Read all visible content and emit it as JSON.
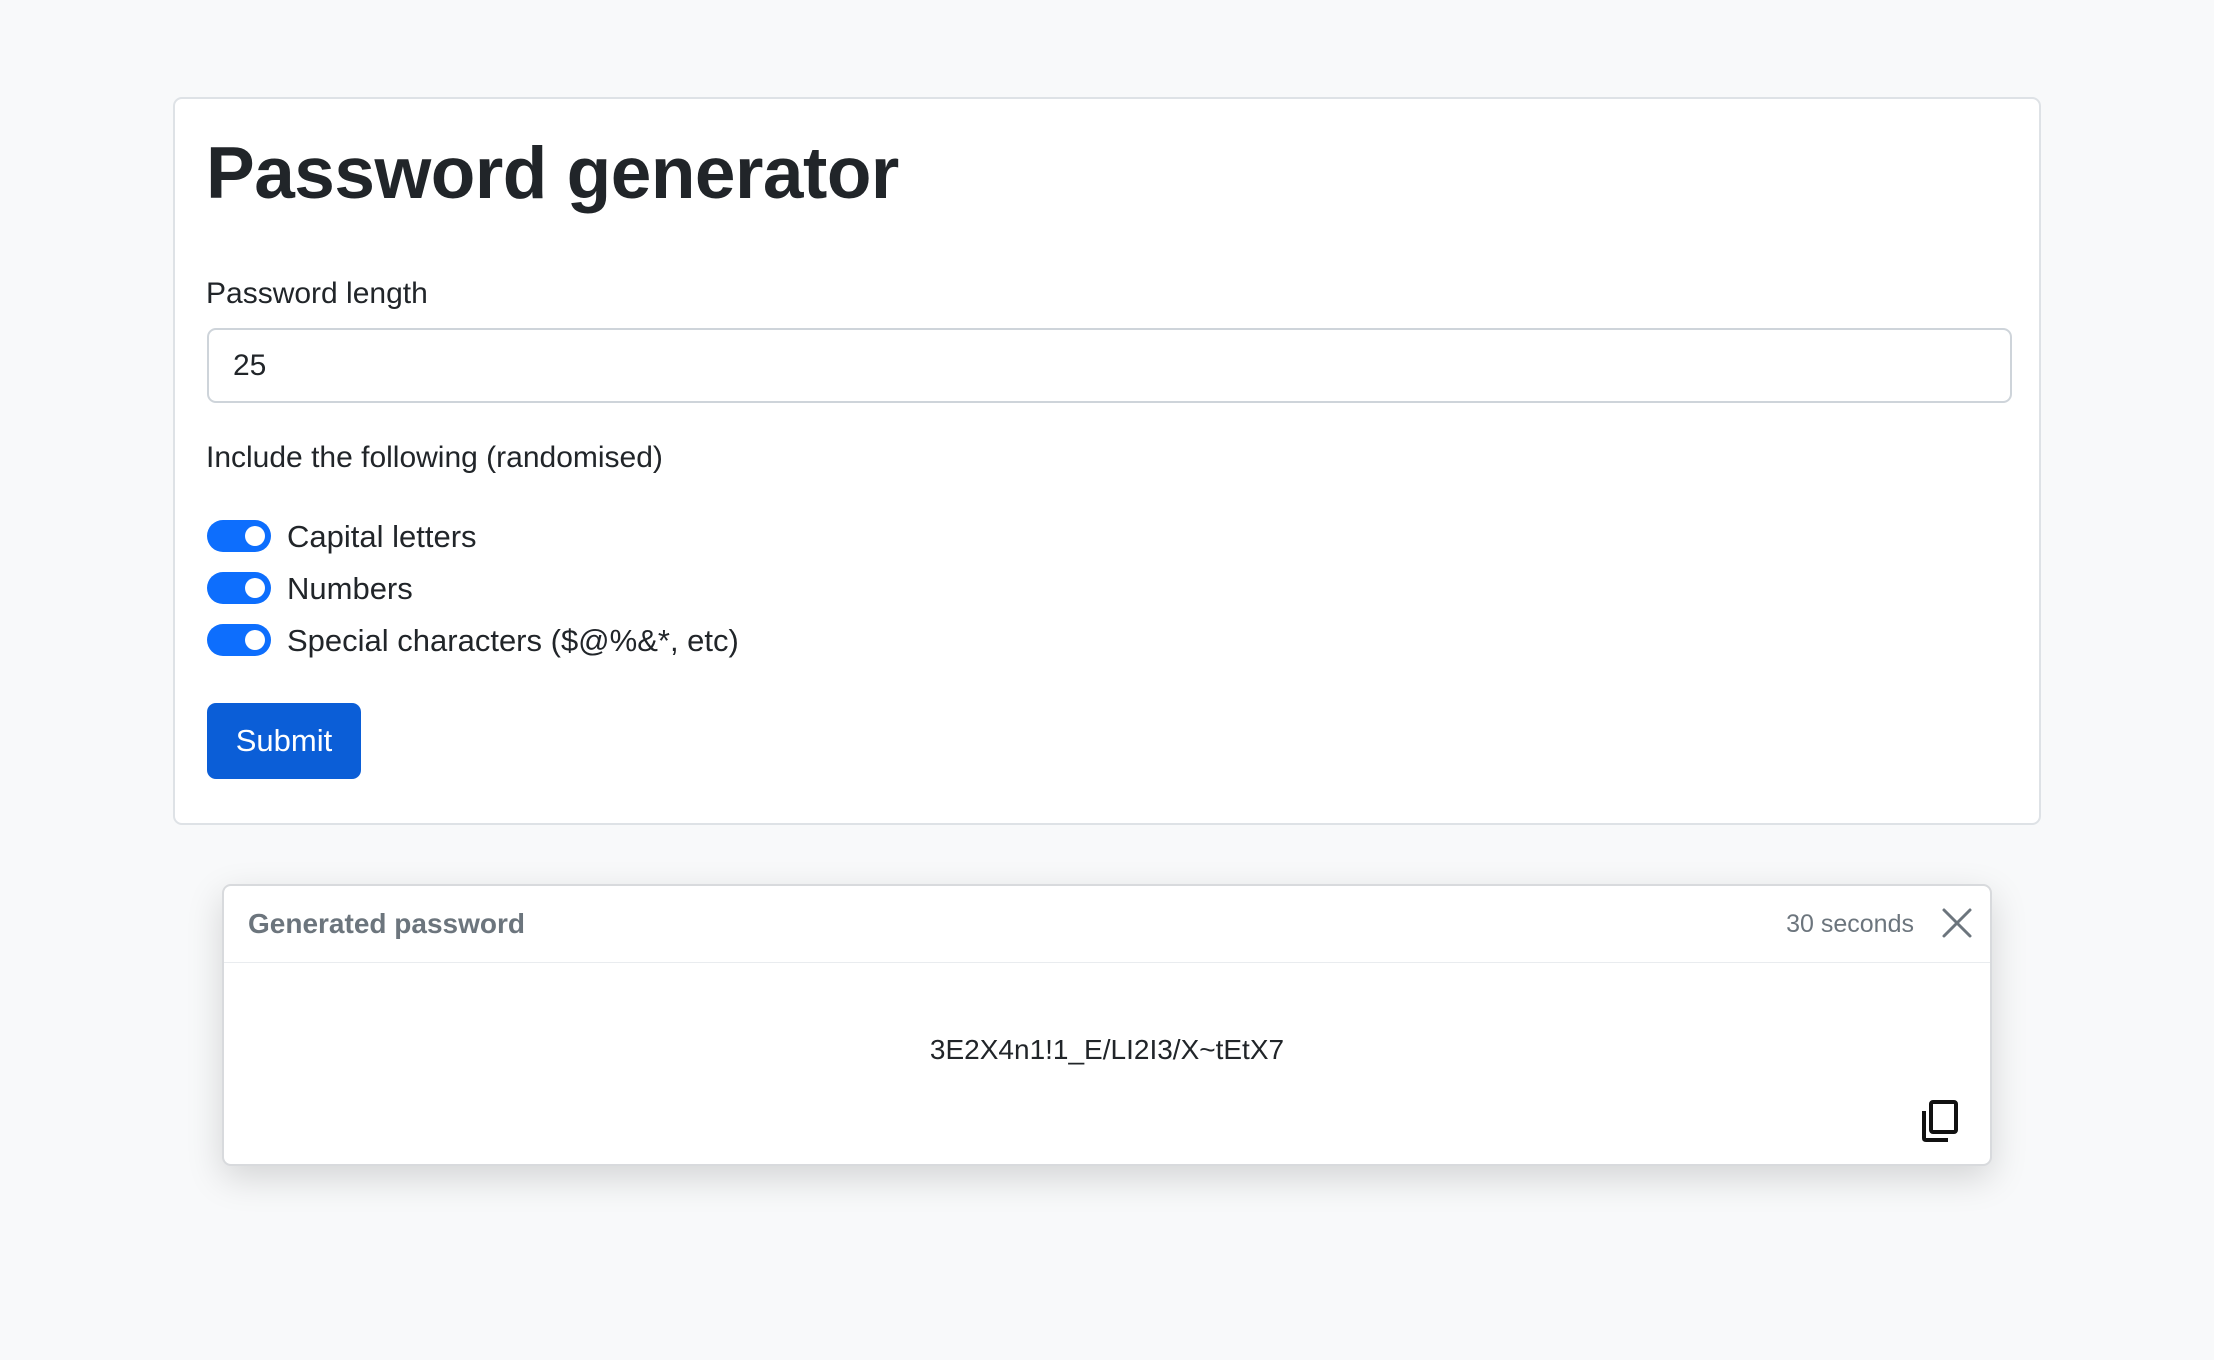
{
  "form": {
    "title": "Password generator",
    "length_label": "Password length",
    "length_value": "25",
    "include_label": "Include the following (randomised)",
    "options": [
      {
        "label": "Capital letters",
        "checked": true
      },
      {
        "label": "Numbers",
        "checked": true
      },
      {
        "label": "Special characters ($@%&*, etc)",
        "checked": true
      }
    ],
    "submit_label": "Submit"
  },
  "toast": {
    "title": "Generated password",
    "time": "30 seconds",
    "password": "3E2X4n1!1_E/LI2I3/X~tEtX7",
    "close_icon": "close-icon",
    "copy_icon": "copy-icon"
  },
  "colors": {
    "accent": "#0d6efd",
    "button": "#0b5ed7",
    "background": "#f8f9fa",
    "muted": "#6c757d"
  }
}
